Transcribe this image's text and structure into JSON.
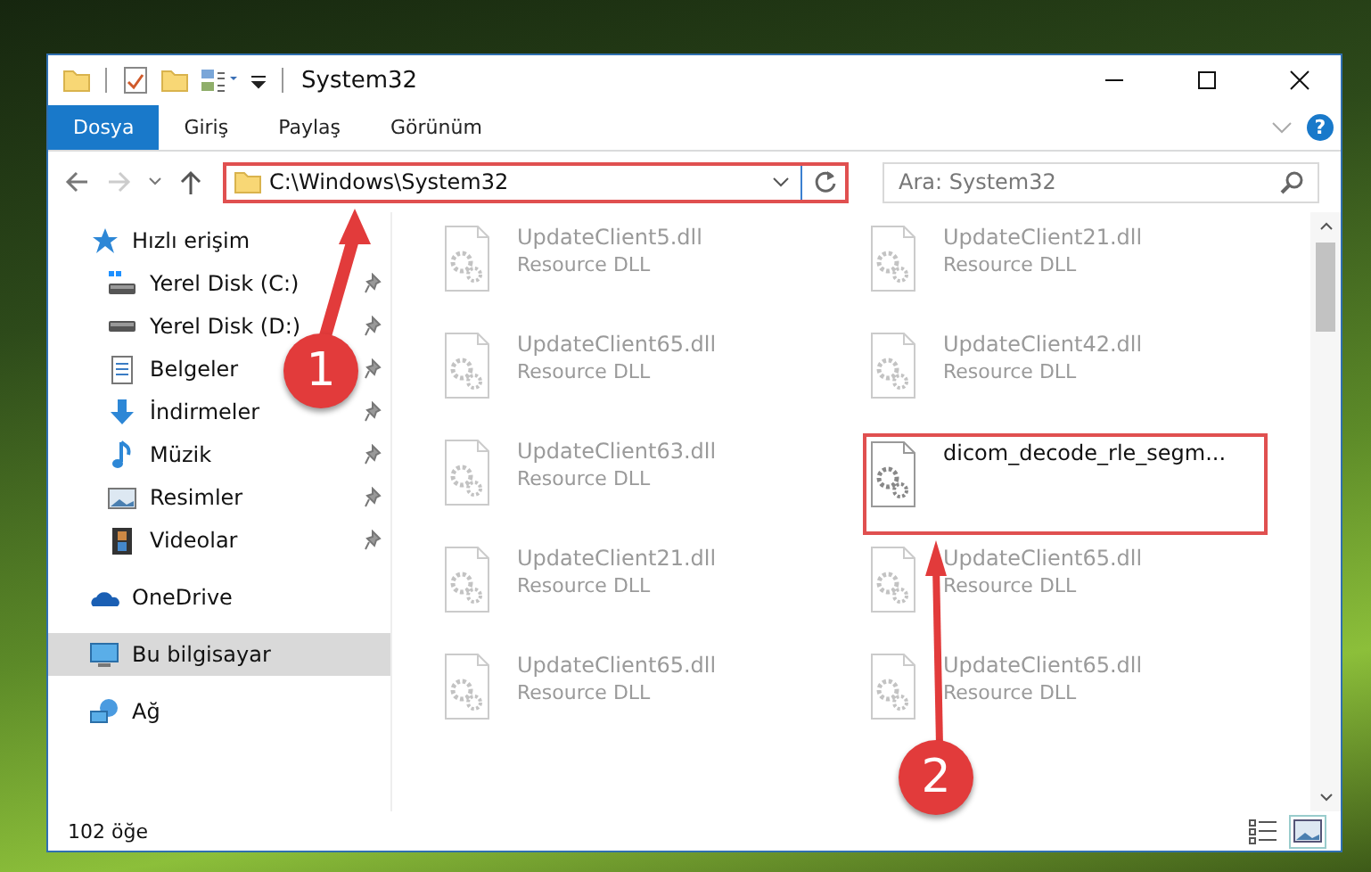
{
  "window": {
    "title": "System32"
  },
  "ribbon_tabs": [
    {
      "label": "Dosya",
      "selected": true
    },
    {
      "label": "Giriş",
      "selected": false
    },
    {
      "label": "Paylaş",
      "selected": false
    },
    {
      "label": "Görünüm",
      "selected": false
    }
  ],
  "help_button": {
    "label": "?"
  },
  "address_bar": {
    "path": "C:\\Windows\\System32"
  },
  "search": {
    "placeholder": "Ara: System32"
  },
  "sidebar": {
    "items": [
      {
        "label": "Hızlı erişim",
        "kind": "star",
        "selected": false,
        "children": [
          {
            "label": "Yerel Disk (C:)",
            "kind": "system-drive",
            "pinned": true
          },
          {
            "label": "Yerel Disk (D:)",
            "kind": "drive",
            "pinned": true
          },
          {
            "label": "Belgeler",
            "kind": "documents",
            "pinned": true
          },
          {
            "label": "İndirmeler",
            "kind": "download",
            "pinned": true
          },
          {
            "label": "Müzik",
            "kind": "music",
            "pinned": true
          },
          {
            "label": "Resimler",
            "kind": "pictures",
            "pinned": true
          },
          {
            "label": "Videolar",
            "kind": "videos",
            "pinned": true
          }
        ]
      },
      {
        "label": "OneDrive",
        "kind": "cloud",
        "selected": false
      },
      {
        "label": "Bu bilgisayar",
        "kind": "computer",
        "selected": true
      },
      {
        "label": "Ağ",
        "kind": "network",
        "selected": false
      }
    ]
  },
  "files": [
    {
      "name": "UpdateClient5.dll",
      "type": "Resource DLL",
      "faded": true,
      "highlighted": false
    },
    {
      "name": "UpdateClient21.dll",
      "type": "Resource DLL",
      "faded": true,
      "highlighted": false
    },
    {
      "name": "UpdateClient65.dll",
      "type": "Resource DLL",
      "faded": true,
      "highlighted": false
    },
    {
      "name": "UpdateClient42.dll",
      "type": "Resource DLL",
      "faded": true,
      "highlighted": false
    },
    {
      "name": "UpdateClient63.dll",
      "type": "Resource DLL",
      "faded": true,
      "highlighted": false
    },
    {
      "name": "dicom_decode_rle_segm...",
      "faded": false,
      "highlighted": true
    },
    {
      "name": "UpdateClient21.dll",
      "type": "Resource DLL",
      "faded": true,
      "highlighted": false
    },
    {
      "name": "UpdateClient65.dll",
      "type": "Resource DLL",
      "faded": true,
      "highlighted": false
    },
    {
      "name": "UpdateClient65.dll",
      "type": "Resource DLL",
      "faded": true,
      "highlighted": false
    },
    {
      "name": "UpdateClient65.dll",
      "type": "Resource DLL",
      "faded": true,
      "highlighted": false
    }
  ],
  "status_bar": {
    "count": "102 öğe",
    "views": [
      {
        "kind": "details",
        "selected": false
      },
      {
        "kind": "large-icons",
        "selected": true
      }
    ]
  },
  "annotations": [
    {
      "label": "1"
    },
    {
      "label": "2"
    }
  ]
}
